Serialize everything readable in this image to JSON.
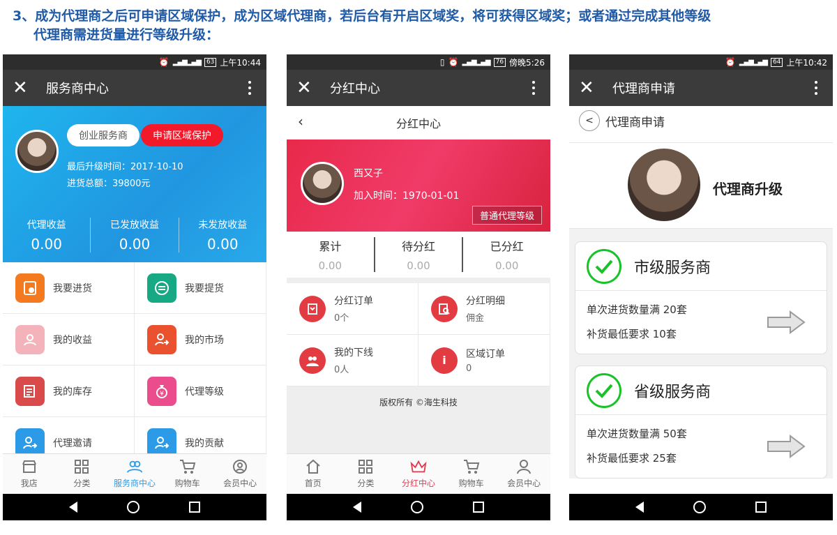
{
  "caption": {
    "line1": "3、成为代理商之后可申请区域保护，成为区域代理商，若后台有开启区域奖，将可获得区域奖；或者通过完成其他等级",
    "line2": "代理商需进货量进行等级升级："
  },
  "screens": [
    {
      "status": {
        "battery": "63",
        "time": "上午10:44"
      },
      "title": "服务商中心",
      "buttons": {
        "startup": "创业服务商",
        "apply": "申请区域保护"
      },
      "meta": {
        "upgrade": "最后升级时间：2017-10-10",
        "total": "进货总额：39800元"
      },
      "stats": [
        {
          "label": "代理收益",
          "value": "0.00"
        },
        {
          "label": "已发放收益",
          "value": "0.00"
        },
        {
          "label": "未发放收益",
          "value": "0.00"
        }
      ],
      "grid": [
        {
          "label": "我要进货",
          "color": "#f47a20"
        },
        {
          "label": "我要提货",
          "color": "#17a884"
        },
        {
          "label": "我的收益",
          "color": "#f4b3bb"
        },
        {
          "label": "我的市场",
          "color": "#e9512f"
        },
        {
          "label": "我的库存",
          "color": "#d94a4a"
        },
        {
          "label": "代理等级",
          "color": "#ea4c8c"
        },
        {
          "label": "代理邀请",
          "color": "#2b9be8"
        },
        {
          "label": "我的贡献",
          "color": "#2b9be8"
        }
      ],
      "tabs": [
        "我店",
        "分类",
        "服务商中心",
        "购物车",
        "会员中心"
      ]
    },
    {
      "status": {
        "battery": "76",
        "time": "傍晚5:26"
      },
      "title": "分红中心",
      "subheader": "分红中心",
      "profile": {
        "name": "西又子",
        "join": "加入时间：1970-01-01",
        "level": "普通代理等级"
      },
      "stats": [
        {
          "label": "累计",
          "value": "0.00"
        },
        {
          "label": "待分红",
          "value": "0.00"
        },
        {
          "label": "已分红",
          "value": "0.00"
        }
      ],
      "grid": [
        {
          "title": "分红订单",
          "sub": "0个"
        },
        {
          "title": "分红明细",
          "sub": "佣金"
        },
        {
          "title": "我的下线",
          "sub": "0人"
        },
        {
          "title": "区域订单",
          "sub": "0"
        }
      ],
      "copyright": "版权所有 ©海生科技",
      "tabs": [
        "首页",
        "分类",
        "分红中心",
        "购物车",
        "会员中心"
      ]
    },
    {
      "status": {
        "battery": "64",
        "time": "上午10:42"
      },
      "title": "代理商申请",
      "subheader": "代理商申请",
      "heading": "代理商升级",
      "cards": [
        {
          "title": "市级服务商",
          "req1": "单次进货数量满 20套",
          "req2": "补货最低要求 10套"
        },
        {
          "title": "省级服务商",
          "req1": "单次进货数量满 50套",
          "req2": "补货最低要求 25套"
        }
      ]
    }
  ],
  "colors": {
    "caption": "#1f5aa6",
    "blue_accent": "#2f9ae6",
    "red_accent": "#e23a52",
    "check_green": "#19c228"
  }
}
